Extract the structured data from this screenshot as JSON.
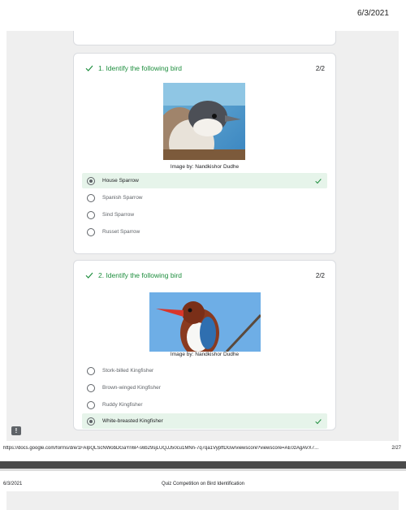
{
  "header": {
    "date": "6/3/2021"
  },
  "questions": [
    {
      "title": "1. Identify the following bird",
      "score": "2/2",
      "image_credit": "Image by: Nandkishor Dudhe",
      "options": [
        {
          "label": "House Sparrow",
          "selected": true,
          "correct": true
        },
        {
          "label": "Spanish Sparrow",
          "selected": false,
          "correct": false
        },
        {
          "label": "Sind Sparrow",
          "selected": false,
          "correct": false
        },
        {
          "label": "Russet Sparrow",
          "selected": false,
          "correct": false
        }
      ]
    },
    {
      "title": "2. Identify the following bird",
      "score": "2/2",
      "image_credit": "Image by: Nandkishor Dudhe",
      "options": [
        {
          "label": "Stork-billed Kingfisher",
          "selected": false,
          "correct": false
        },
        {
          "label": "Brown-winged Kingfisher",
          "selected": false,
          "correct": false
        },
        {
          "label": "Ruddy Kingfisher",
          "selected": false,
          "correct": false
        },
        {
          "label": "White-breasted Kingfisher",
          "selected": true,
          "correct": true
        }
      ]
    }
  ],
  "footer": {
    "url": "https://docs.google.com/forms/d/e/1FAIpQLScNWobDGaYn6P-s6b29sjLUQJJ50cu1MNn-7q7qa1VypffDGw/viewscore?viewscore=AE0zAgAVX7...",
    "page": "2/27"
  },
  "next_page": {
    "date": "6/3/2021",
    "title": "Quiz Competition on Bird Identification"
  },
  "colors": {
    "correct": "#1e8e3e",
    "correct_bg": "#e6f4ea",
    "form_bg": "#efefef"
  },
  "icons": {
    "correct": "check-icon",
    "feedback": "feedback-icon"
  }
}
